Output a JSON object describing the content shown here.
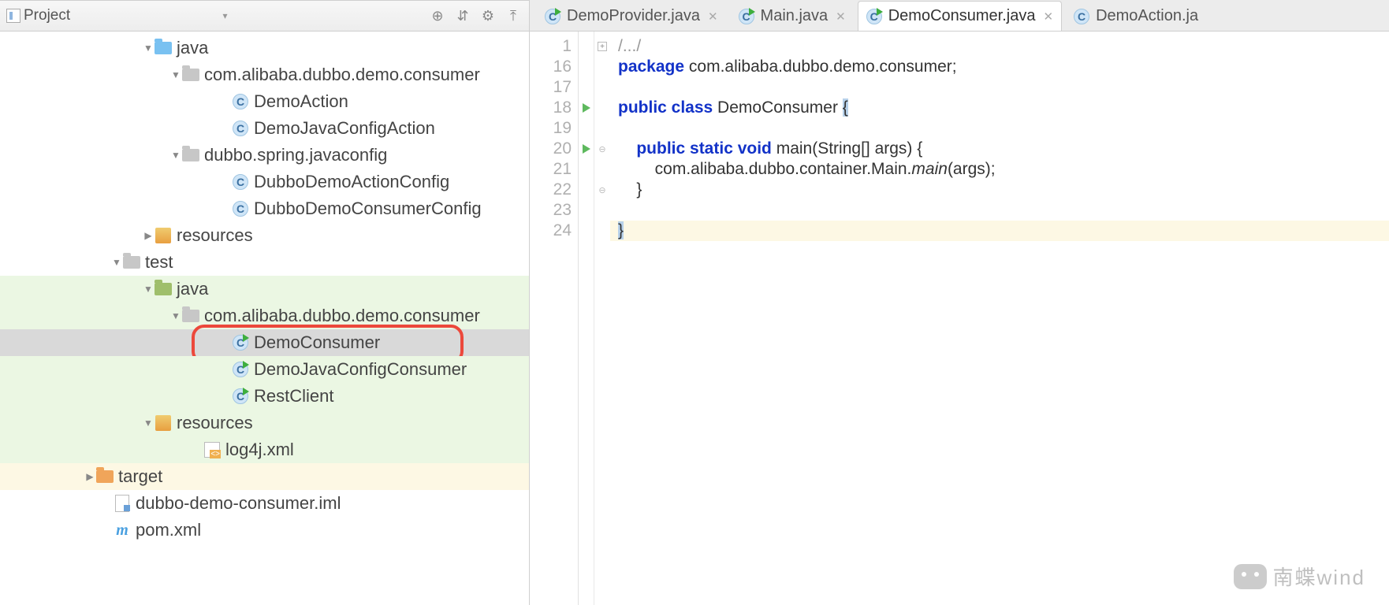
{
  "project_panel": {
    "title": "Project"
  },
  "tree": [
    {
      "indent": 180,
      "arrow": "down",
      "icon": "folder-blue",
      "label": "java",
      "bg": ""
    },
    {
      "indent": 215,
      "arrow": "down",
      "icon": "folder-grey",
      "label": "com.alibaba.dubbo.demo.consumer",
      "bg": ""
    },
    {
      "indent": 278,
      "arrow": "",
      "icon": "class",
      "label": "DemoAction",
      "bg": ""
    },
    {
      "indent": 278,
      "arrow": "",
      "icon": "class",
      "label": "DemoJavaConfigAction",
      "bg": ""
    },
    {
      "indent": 215,
      "arrow": "down",
      "icon": "folder-grey",
      "label": "dubbo.spring.javaconfig",
      "bg": ""
    },
    {
      "indent": 278,
      "arrow": "",
      "icon": "class",
      "label": "DubboDemoActionConfig",
      "bg": ""
    },
    {
      "indent": 278,
      "arrow": "",
      "icon": "class",
      "label": "DubboDemoConsumerConfig",
      "bg": ""
    },
    {
      "indent": 180,
      "arrow": "right",
      "icon": "res",
      "label": "resources",
      "bg": ""
    },
    {
      "indent": 140,
      "arrow": "down",
      "icon": "folder-grey",
      "label": "test",
      "bg": ""
    },
    {
      "indent": 180,
      "arrow": "down",
      "icon": "folder-olive",
      "label": "java",
      "bg": "green"
    },
    {
      "indent": 215,
      "arrow": "down",
      "icon": "folder-grey",
      "label": "com.alibaba.dubbo.demo.consumer",
      "bg": "green"
    },
    {
      "indent": 278,
      "arrow": "",
      "icon": "class-run",
      "label": "DemoConsumer",
      "bg": "sel",
      "boxed": true
    },
    {
      "indent": 278,
      "arrow": "",
      "icon": "class-run",
      "label": "DemoJavaConfigConsumer",
      "bg": "green"
    },
    {
      "indent": 278,
      "arrow": "",
      "icon": "class-run",
      "label": "RestClient",
      "bg": "green"
    },
    {
      "indent": 180,
      "arrow": "down",
      "icon": "res",
      "label": "resources",
      "bg": "green"
    },
    {
      "indent": 242,
      "arrow": "",
      "icon": "xml",
      "label": "log4j.xml",
      "bg": "green"
    },
    {
      "indent": 106,
      "arrow": "right",
      "icon": "folder-orange",
      "label": "target",
      "bg": "yellow"
    },
    {
      "indent": 128,
      "arrow": "",
      "icon": "iml",
      "label": "dubbo-demo-consumer.iml",
      "bg": ""
    },
    {
      "indent": 128,
      "arrow": "",
      "icon": "m",
      "label": "pom.xml",
      "bg": ""
    }
  ],
  "tabs": [
    {
      "label": "DemoProvider.java",
      "icon": "class-run",
      "active": false
    },
    {
      "label": "Main.java",
      "icon": "class-run",
      "active": false
    },
    {
      "label": "DemoConsumer.java",
      "icon": "class-run",
      "active": true
    },
    {
      "label": "DemoAction.ja",
      "icon": "class",
      "active": false,
      "noclose": true
    }
  ],
  "code": {
    "lines": [
      "1",
      "16",
      "17",
      "18",
      "19",
      "20",
      "21",
      "22",
      "23",
      "24"
    ],
    "fold1": "/.../",
    "pkg_kw": "package",
    "pkg": " com.alibaba.dubbo.demo.consumer;",
    "cls_pub": "public class",
    "cls_name": " DemoConsumer ",
    "brace_open": "{",
    "m_pub": "public static void",
    "m_sig": " main(String[] args) {",
    "body": "        com.alibaba.dubbo.container.Main.",
    "body_it": "main",
    "body_end": "(args);",
    "close1": "    }",
    "close2": "}"
  },
  "watermark": "南蝶wind"
}
